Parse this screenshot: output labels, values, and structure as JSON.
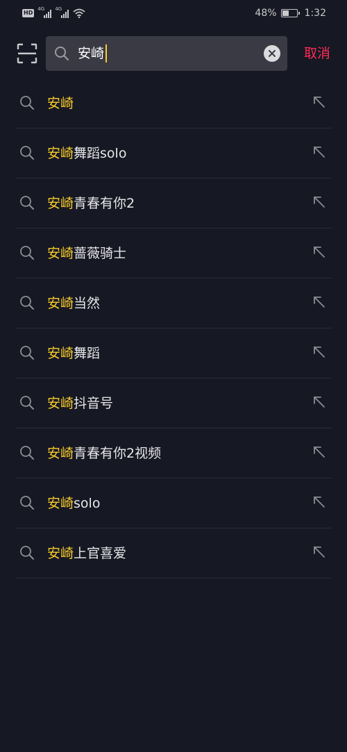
{
  "status_bar": {
    "hd_label": "HD",
    "network_1": "4G",
    "network_2": "4G",
    "battery_text": "48%",
    "battery_level": 0.48,
    "time": "1:32"
  },
  "search": {
    "scan_icon": "scan-icon",
    "search_icon": "search-icon",
    "query": "安崎",
    "clear_icon": "close-circle-icon",
    "cancel_label": "取消"
  },
  "colors": {
    "background": "#161823",
    "highlight": "#facd2d",
    "cancel": "#fe2c55",
    "search_box": "#3a3a44"
  },
  "suggestions": [
    {
      "highlight": "安崎",
      "rest": ""
    },
    {
      "highlight": "安崎",
      "rest": "舞蹈solo"
    },
    {
      "highlight": "安崎",
      "rest": "青春有你2"
    },
    {
      "highlight": "安崎",
      "rest": "蔷薇骑士"
    },
    {
      "highlight": "安崎",
      "rest": "当然"
    },
    {
      "highlight": "安崎",
      "rest": "舞蹈"
    },
    {
      "highlight": "安崎",
      "rest": "抖音号"
    },
    {
      "highlight": "安崎",
      "rest": "青春有你2视频"
    },
    {
      "highlight": "安崎",
      "rest": "solo"
    },
    {
      "highlight": "安崎",
      "rest": "上官喜爱"
    }
  ]
}
